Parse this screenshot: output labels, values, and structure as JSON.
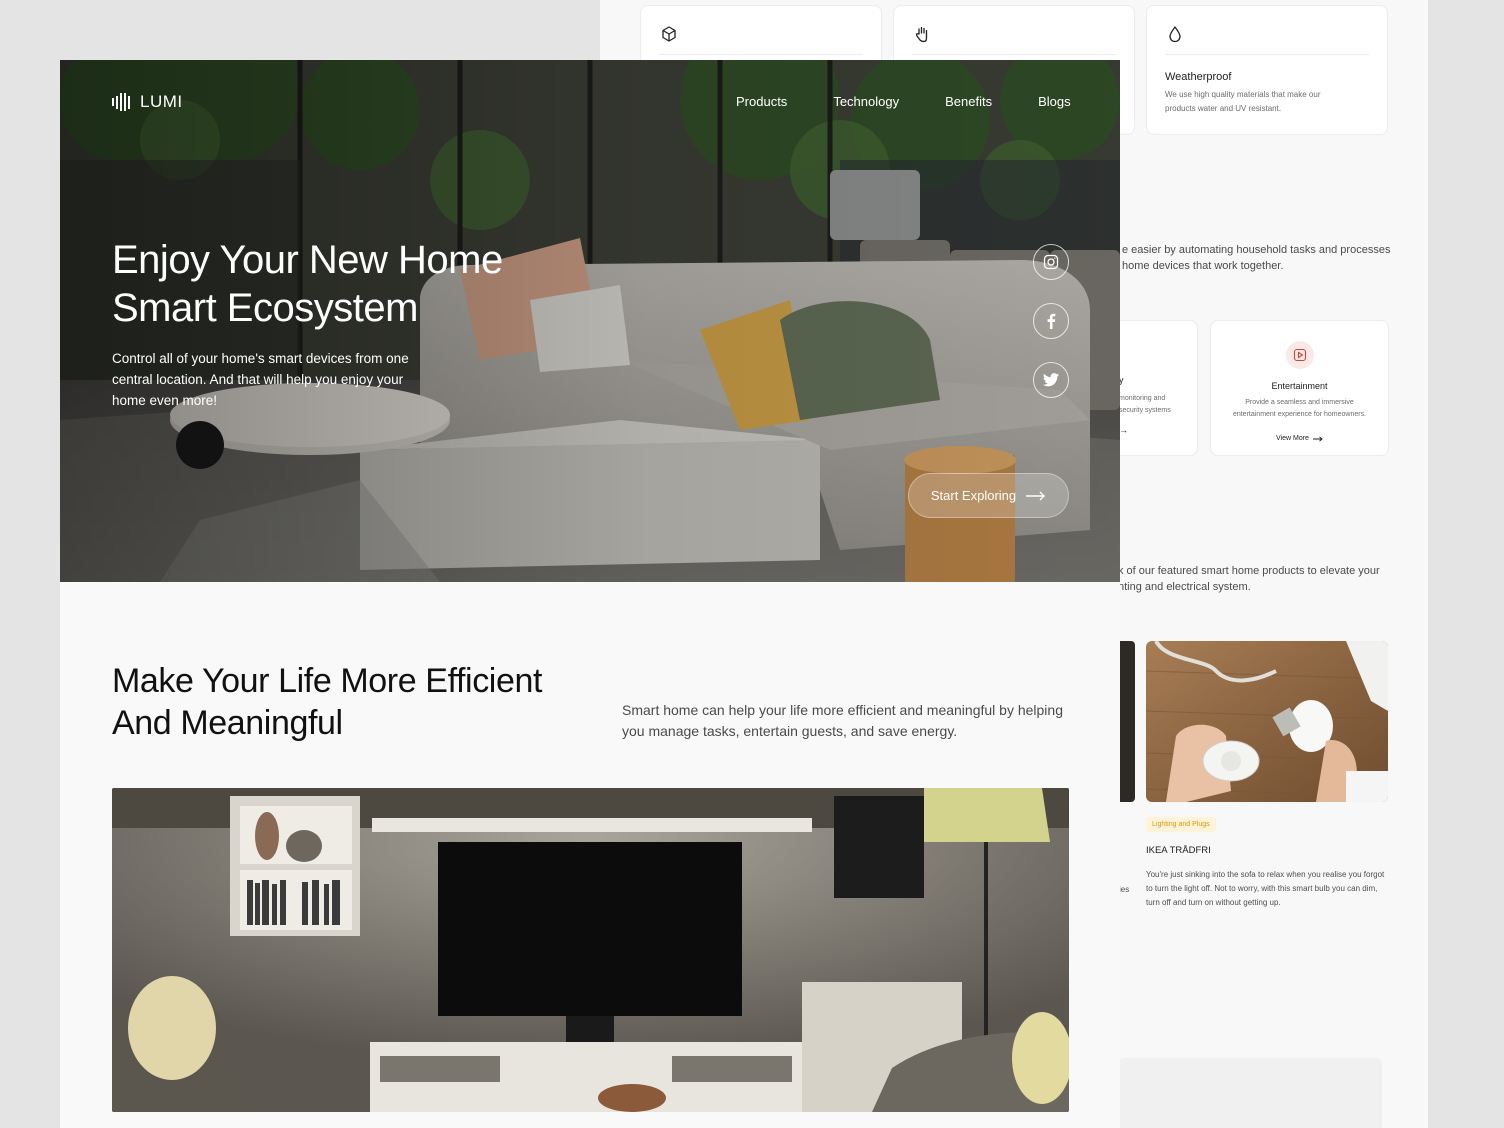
{
  "back_page": {
    "feature_cards": [
      {
        "icon": "cube-icon",
        "title": "",
        "desc": ""
      },
      {
        "icon": "hand-icon",
        "title": "",
        "desc": ""
      },
      {
        "icon": "drop-icon",
        "title": "Weatherproof",
        "desc": "We use high quality materials that make our products water and UV resistant."
      }
    ],
    "intro_line1": "e easier by automating household tasks and processes",
    "intro_line2": "home devices that work together.",
    "service_left": {
      "title": "y",
      "desc_line1": "monitoring and",
      "desc_line2": "security systems",
      "link": "→"
    },
    "service_right": {
      "title": "Entertainment",
      "desc": "Provide a seamless and immersive entertainment experience for homeowners.",
      "link": "View More"
    },
    "products_line1": "k of our featured smart home products to elevate your",
    "products_line2": "hting and electrical system.",
    "product": {
      "tag": "Lighting and Plugs",
      "title": "IKEA TRÅDFRI",
      "desc": "You're just sinking into the sofa to relax when you realise you forgot to turn the light off. Not to worry, with this smart bulb you can dim, turn off and turn on without getting up.",
      "side_fragment": "ies"
    }
  },
  "front_page": {
    "brand": "LUMI",
    "nav": [
      "Products",
      "Technology",
      "Benefits",
      "Blogs"
    ],
    "hero": {
      "title": "Enjoy Your New Home Smart Ecosystem",
      "subtitle": "Control all of your home's smart devices from one central location. And that will help you enjoy your home even more!",
      "cta": "Start Exploring"
    },
    "social": [
      "instagram-icon",
      "facebook-icon",
      "twitter-icon"
    ],
    "section": {
      "title": "Make Your Life More Efficient And Meaningful",
      "desc": "Smart home can help your life more efficient and meaningful by helping you manage tasks, entertain guests, and save energy."
    }
  },
  "colors": {
    "page_bg": "#e4e4e4",
    "surface": "#f9f9f9",
    "text_dark": "#111111",
    "tag_text": "#d29a0a",
    "tag_bg": "#fdf3d9",
    "icon_accent": "#c0473a"
  }
}
